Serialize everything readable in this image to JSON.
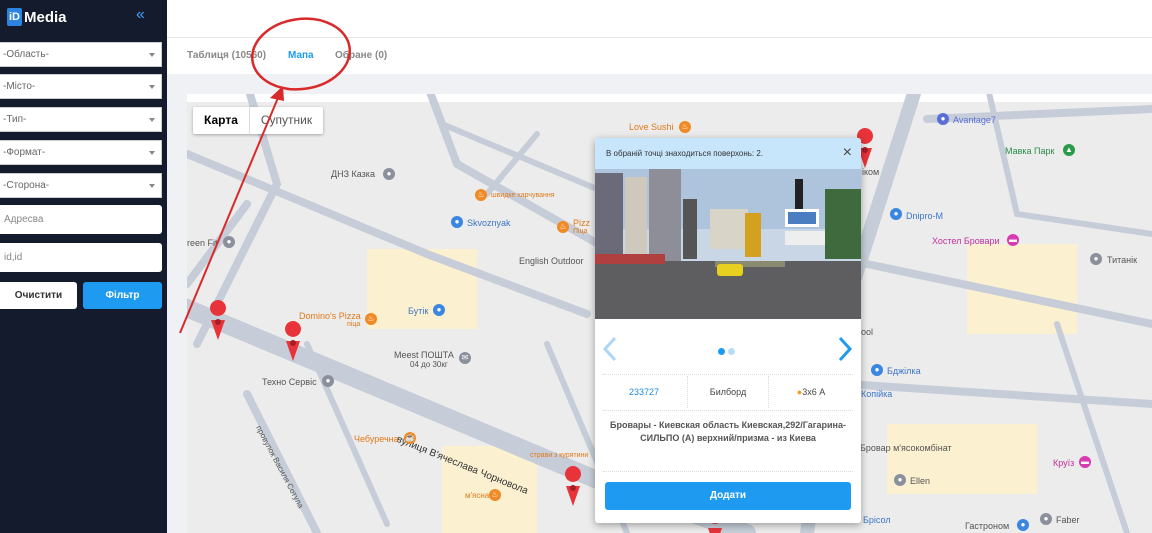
{
  "app": {
    "logo_box": "iD",
    "logo_text": "Media"
  },
  "sidebar": {
    "collapse_glyph": "«",
    "selects": [
      "-Область-",
      "-Місто-",
      "-Тип-",
      "-Формат-",
      "-Сторона-"
    ],
    "address_placeholder": "Адресва",
    "id_placeholder": "id,id",
    "clear_label": "Очистити",
    "filter_label": "Фільтр"
  },
  "tabs": {
    "table": "Таблиця (10560)",
    "map": "Мапа",
    "favorites": "Обране (0)"
  },
  "map": {
    "type_map": "Карта",
    "type_satellite": "Супутник",
    "labels": {
      "love_sushi": "Love Sushi",
      "avantage": "Avantage7",
      "mavka": "Мавка Парк",
      "dnz": "ДНЗ Казка",
      "shvydke": "швидке харчування",
      "skvoznyak": "Skvoznyak",
      "pizza_partial": "Pizz",
      "pizza_partial_sub": "Піца",
      "dnipro": "Dnipro-M",
      "hostel": "Хостел Бровари",
      "green_fit": "reen Fit",
      "english": "English Outdoor",
      "titanik": "Титанік",
      "dominos": "Domino's Pizza",
      "dominos_sub": "піца",
      "butik": "Бутік",
      "meest": "Meest ПОШТА",
      "meest_sub": "04 до 30кг",
      "tehno": "Техно Сервіс",
      "street_main": "вулиця В'ячеслава Чорновола",
      "street_side": "провулок Василя Сотула",
      "chebur": "Чебуречна",
      "strava": "страви з курятини",
      "mjasna": "м'ясна",
      "ool": "ool",
      "bdzhilka": "Бджілка",
      "kopiyka": "Копійка",
      "myaso": "Бровар м'ясокомбінат",
      "kruiz": "Круїз",
      "ellen": "Ellen",
      "gastronom": "Гастроном",
      "faber": "Faber",
      "brisol": "Брісол",
      "lyktom": "іком"
    }
  },
  "popup": {
    "header": "В обраній точці знаходиться поверхонь: 2.",
    "close": "×",
    "id": "233727",
    "type": "Билборд",
    "size": "3х6 А",
    "address": "Бровары - Киевская область Киевская,292/Гагарина-СИЛЬПО (А) верхний/призма - из Киева",
    "add_label": "Додати"
  },
  "colors": {
    "accent": "#1e9bf0",
    "sidebar": "#141b2d",
    "annotation": "#d82a2a"
  }
}
